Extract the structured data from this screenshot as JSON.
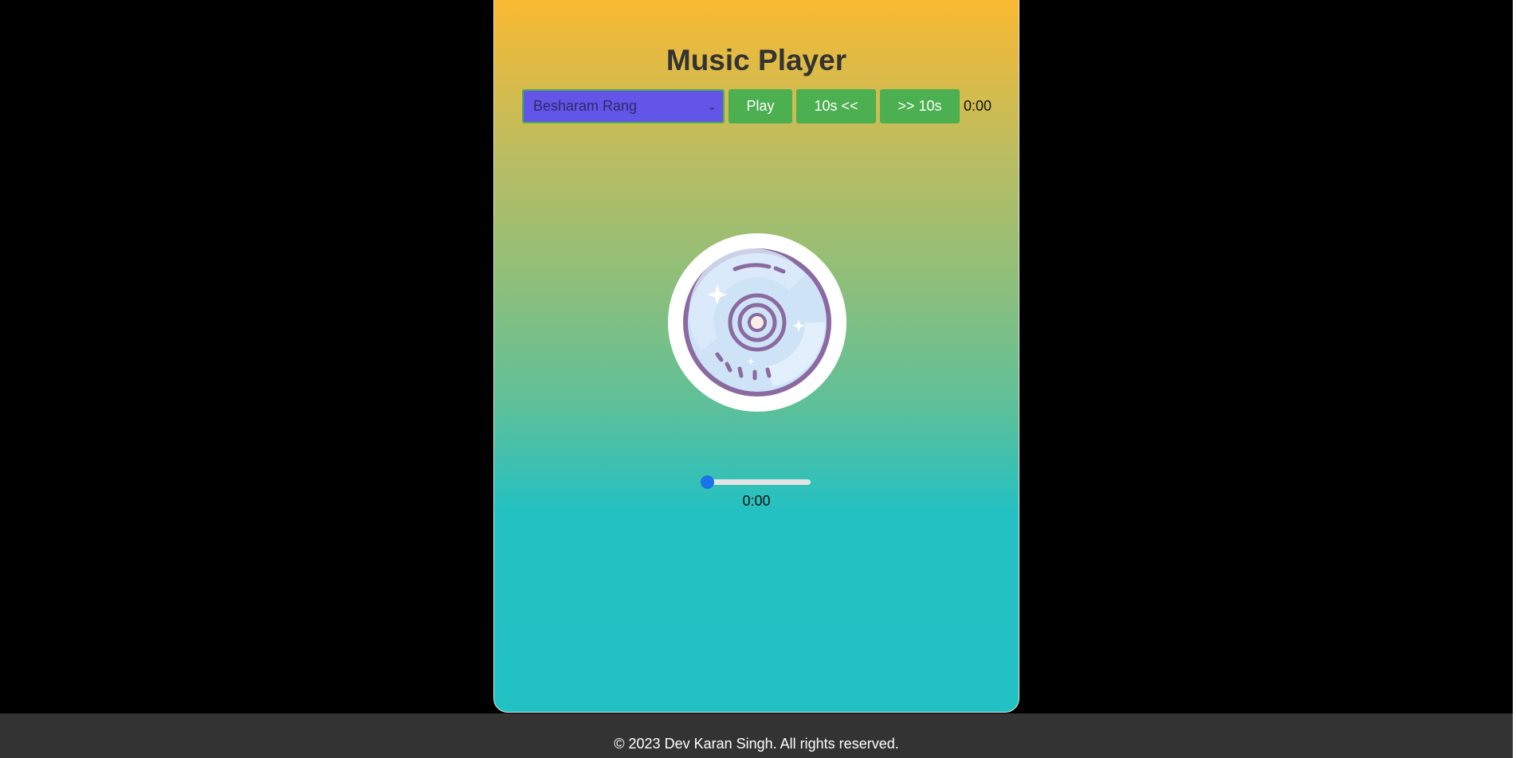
{
  "app": {
    "title": "Music Player"
  },
  "controls": {
    "selected_song": "Besharam Rang",
    "play_label": "Play",
    "rewind_label": "10s <<",
    "forward_label": ">> 10s",
    "current_time": "0:00"
  },
  "seek": {
    "progress": 0,
    "time_label": "0:00"
  },
  "footer": {
    "text": "© 2023 Dev Karan Singh. All rights reserved."
  },
  "colors": {
    "button_bg": "#4caf50",
    "select_bg": "#6355e8",
    "slider_thumb": "#1a73e8",
    "footer_bg": "#333333"
  },
  "icons": {
    "disc": "compact-disc-icon",
    "select_arrow": "chevron-down-icon"
  }
}
